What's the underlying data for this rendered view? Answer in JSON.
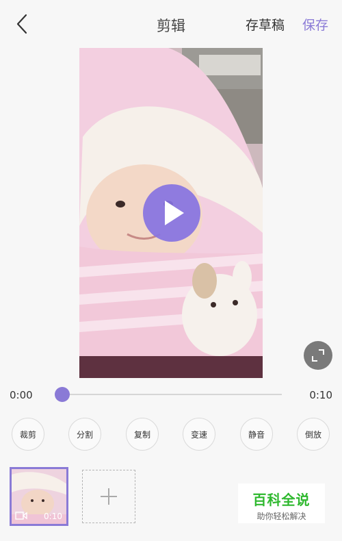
{
  "header": {
    "title": "剪辑",
    "draft_label": "存草稿",
    "save_label": "保存"
  },
  "colors": {
    "accent": "#8a7ad6",
    "play_button": "#8773e1",
    "background": "#f7f7f7"
  },
  "playback": {
    "current_time": "0:00",
    "total_time": "0:10",
    "progress": 0.0
  },
  "tools": [
    {
      "label": "裁剪"
    },
    {
      "label": "分割"
    },
    {
      "label": "复制"
    },
    {
      "label": "变速"
    },
    {
      "label": "静音"
    },
    {
      "label": "倒放"
    }
  ],
  "clips": [
    {
      "duration": "0:10"
    }
  ],
  "watermark": {
    "title": "百科全说",
    "subtitle": "助你轻松解决"
  }
}
